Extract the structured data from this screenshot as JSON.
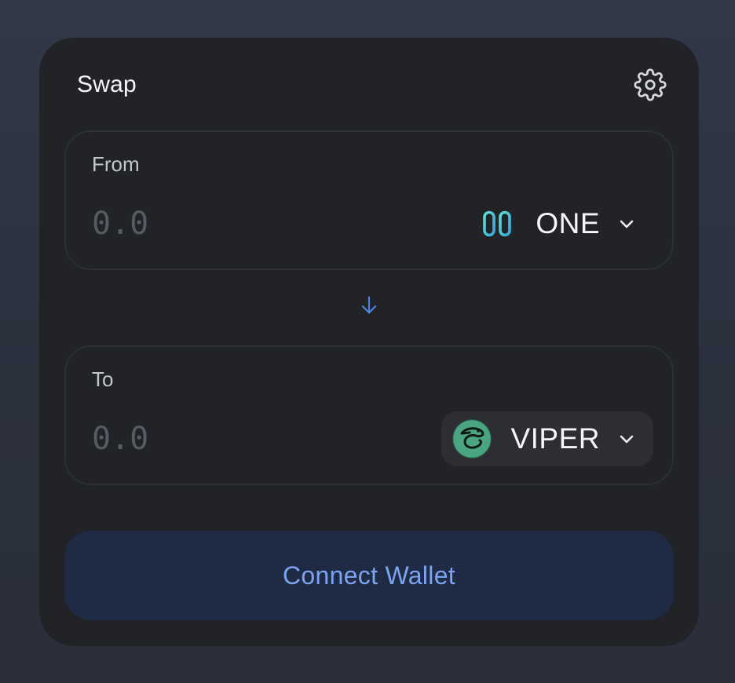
{
  "swap": {
    "title": "Swap",
    "settings_icon": "gear-icon"
  },
  "from": {
    "label": "From",
    "amount_placeholder": "0.0",
    "amount_value": "",
    "token": {
      "symbol": "ONE",
      "icon": "harmony-one-logo"
    }
  },
  "switch_icon": "arrow-down-icon",
  "to": {
    "label": "To",
    "amount_placeholder": "0.0",
    "amount_value": "",
    "token": {
      "symbol": "VIPER",
      "icon": "viper-logo"
    }
  },
  "connect_button": {
    "label": "Connect Wallet"
  },
  "colors": {
    "page_background": "#2e3341",
    "card_background": "#212327",
    "panel_border": "#2c2f36",
    "accent": "#7ba3f0",
    "arrow": "#4d86e6",
    "connect_button_background": "#1f2b44",
    "placeholder": "#565b66"
  }
}
